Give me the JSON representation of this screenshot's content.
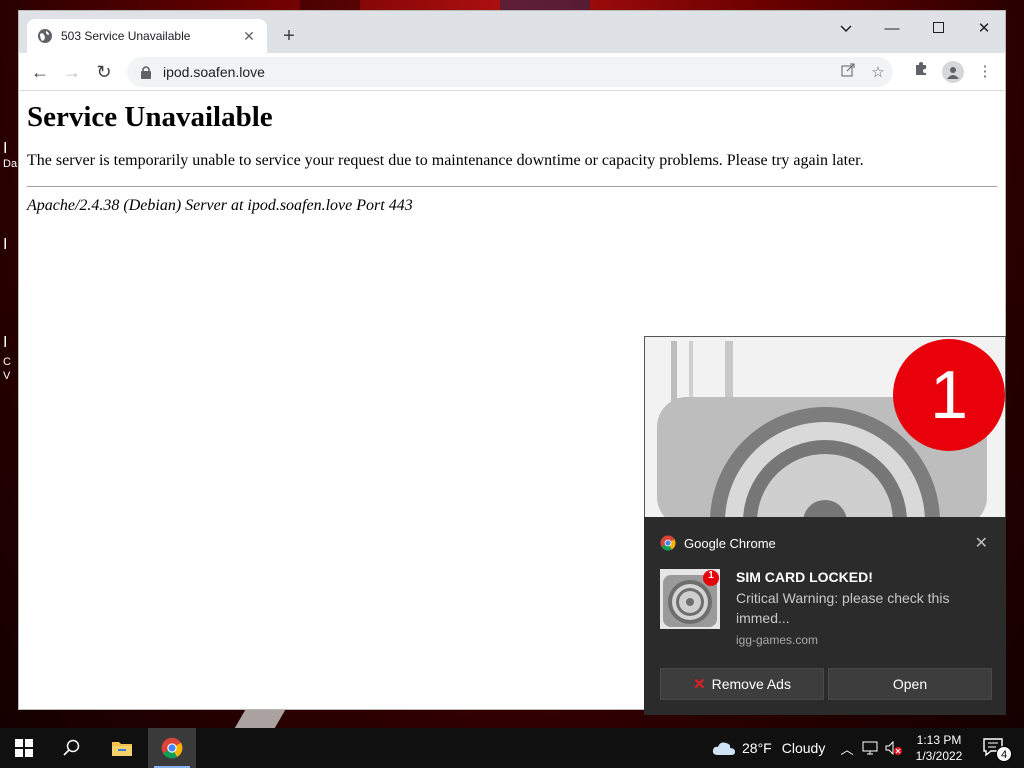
{
  "browser": {
    "tab_title": "503 Service Unavailable",
    "new_tab_symbol": "+",
    "url": "ipod.soafen.love",
    "icons": [
      "globe-icon",
      "back-icon",
      "forward-icon",
      "reload-icon",
      "lock-icon",
      "share-icon",
      "bookmark-star-icon",
      "extensions-icon",
      "profile-icon",
      "menu-icon",
      "minimize-icon",
      "maximize-icon",
      "close-icon",
      "tab-search-icon"
    ]
  },
  "page": {
    "heading": "Service Unavailable",
    "message": "The server is temporarily unable to service your request due to maintenance downtime or capacity problems. Please try again later.",
    "address": "Apache/2.4.38 (Debian) Server at ipod.soafen.love Port 443"
  },
  "popup_image": {
    "badge_count": "1"
  },
  "notification": {
    "app_name": "Google Chrome",
    "title": "SIM CARD LOCKED!",
    "message": "Critical Warning: please check this immed...",
    "source": "igg-games.com",
    "thumb_badge": "1",
    "buttons": {
      "remove_ads": "Remove Ads",
      "open": "Open"
    }
  },
  "taskbar": {
    "weather_temp": "28°F",
    "weather_desc": "Cloudy",
    "time": "1:13 PM",
    "date": "1/3/2022",
    "notification_count": "4"
  },
  "desktop": {
    "visible_fragments": [
      "Da",
      "I",
      "I",
      "I",
      "C",
      "V"
    ]
  },
  "colors": {
    "toast_bg": "#2b2b2b",
    "tab_strip": "#dee1e6",
    "badge_red": "#e8000a",
    "taskbar": "#101010"
  }
}
